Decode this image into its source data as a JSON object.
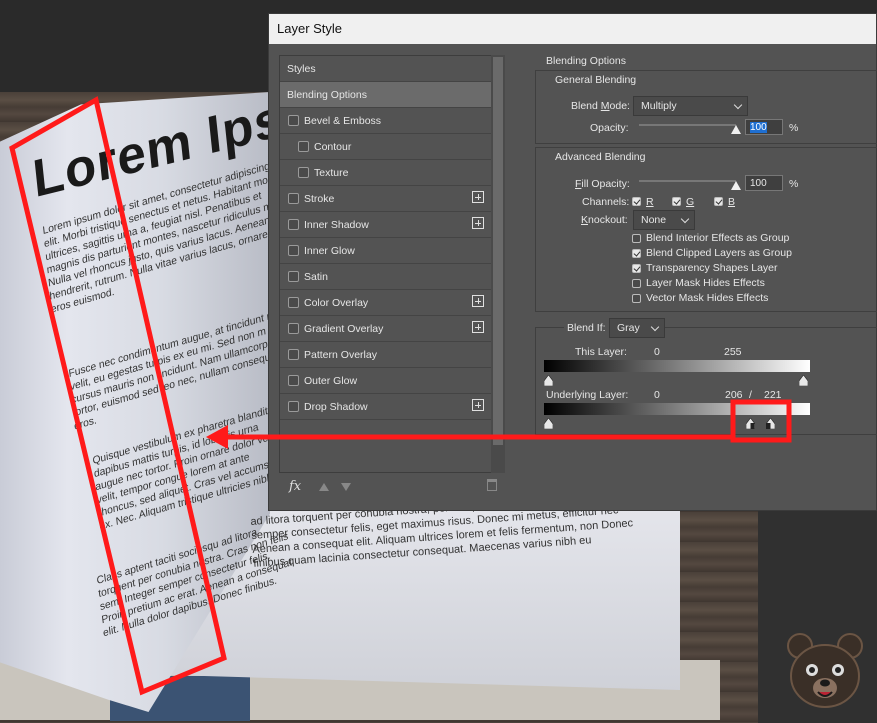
{
  "scene": {
    "title": "Lorem Ips",
    "left_text_1": "Lorem ipsum dolor sit amet, consectetur adipiscing elit. Morbi tristique senectus et netus. Habitant morbi ultrices, sagittis urna a, feugiat nisl. Penatibus et magnis dis parturient montes, nascetur ridiculus mus. Nulla vel rhoncus justo, quis varius lacus. Aenean hendrerit, rutrum. Nulla vitae varius lacus, ornare eros euismod.",
    "left_text_2": "Fusce nec condimentum augue, at tincidunt mi. Sed velit, eu egestas turpis ex eu mi. Sed non m sodales cursus mauris non tincidunt. Nam ullamcorper risus tortor, euismod sed leo nec, nullam consequat non id eros.",
    "left_text_3": "Quisque vestibulum ex pharetra blandit dapibus mattis turpis, id lobortis urna augue nec tortor. Proin ornare dolor vel velit, tempor congue lorem at ante rhoncus, sed aliquet. Cras vel accumsan ex. Nec. Aliquam tristique ultricies nibh.",
    "left_text_4": "Class aptent taciti sociosqu ad litora torquent per conubia nostra. Cras non felis sem. Integer semper consectetur felis. Proin pretium ac erat. Aenean a consequat elit. Nulla dolor dapibus. Donec finibus.",
    "bottom_text": "ad litora torquent per conubia nostra, per inceptos himenaeos. Cras non semper consectetur felis, eget maximus risus. Donec mi metus, efficitur nec Aenean a consequat elit. Aliquam ultrices lorem et felis fermentum, non Donec finibus quam lacinia consectetur consequat. Maecenas varius nibh eu"
  },
  "dialog": {
    "title": "Layer Style",
    "styles_list": [
      {
        "label": "Styles",
        "check": false,
        "plus": false,
        "sub": false,
        "active": false,
        "header": true
      },
      {
        "label": "Blending Options",
        "check": false,
        "plus": false,
        "sub": false,
        "active": true,
        "header": true
      },
      {
        "label": "Bevel & Emboss",
        "check": true,
        "plus": false,
        "sub": false
      },
      {
        "label": "Contour",
        "check": true,
        "plus": false,
        "sub": true
      },
      {
        "label": "Texture",
        "check": true,
        "plus": false,
        "sub": true
      },
      {
        "label": "Stroke",
        "check": true,
        "plus": true,
        "sub": false
      },
      {
        "label": "Inner Shadow",
        "check": true,
        "plus": true,
        "sub": false
      },
      {
        "label": "Inner Glow",
        "check": true,
        "plus": false,
        "sub": false
      },
      {
        "label": "Satin",
        "check": true,
        "plus": false,
        "sub": false
      },
      {
        "label": "Color Overlay",
        "check": true,
        "plus": true,
        "sub": false
      },
      {
        "label": "Gradient Overlay",
        "check": true,
        "plus": true,
        "sub": false
      },
      {
        "label": "Pattern Overlay",
        "check": true,
        "plus": false,
        "sub": false
      },
      {
        "label": "Outer Glow",
        "check": true,
        "plus": false,
        "sub": false
      },
      {
        "label": "Drop Shadow",
        "check": true,
        "plus": true,
        "sub": false
      }
    ],
    "fx_label": "fx",
    "blending": {
      "section_title": "Blending Options",
      "general_title": "General Blending",
      "blend_mode_label": "Blend Mode:",
      "blend_mode_value": "Multiply",
      "opacity_label": "Opacity:",
      "opacity_value": "100",
      "opacity_unit": "%",
      "opacity_slider_value": 1.0,
      "advanced_title": "Advanced Blending",
      "fill_opacity_label": "Fill Opacity:",
      "fill_opacity_value": "100",
      "fill_opacity_unit": "%",
      "channels_label": "Channels:",
      "channels": [
        {
          "label": "R",
          "checked": true
        },
        {
          "label": "G",
          "checked": true
        },
        {
          "label": "B",
          "checked": true
        }
      ],
      "knockout_label": "Knockout:",
      "knockout_value": "None",
      "options": [
        {
          "label": "Blend Interior Effects as Group",
          "checked": false
        },
        {
          "label": "Blend Clipped Layers as Group",
          "checked": true
        },
        {
          "label": "Transparency Shapes Layer",
          "checked": true
        },
        {
          "label": "Layer Mask Hides Effects",
          "checked": false
        },
        {
          "label": "Vector Mask Hides Effects",
          "checked": false
        }
      ],
      "blend_if_label": "Blend If:",
      "blend_if_value": "Gray",
      "this_layer_label": "This Layer:",
      "this_layer_low": "0",
      "this_layer_high": "255",
      "underlying_label": "Underlying Layer:",
      "underlying_low": "0",
      "underlying_high_a": "206",
      "underlying_sep": "/",
      "underlying_high_b": "221"
    }
  },
  "colors": {
    "annotation_red": "#ff1a1a",
    "dialog_bg": "#535353",
    "selection_blue": "#1f6fd1"
  }
}
